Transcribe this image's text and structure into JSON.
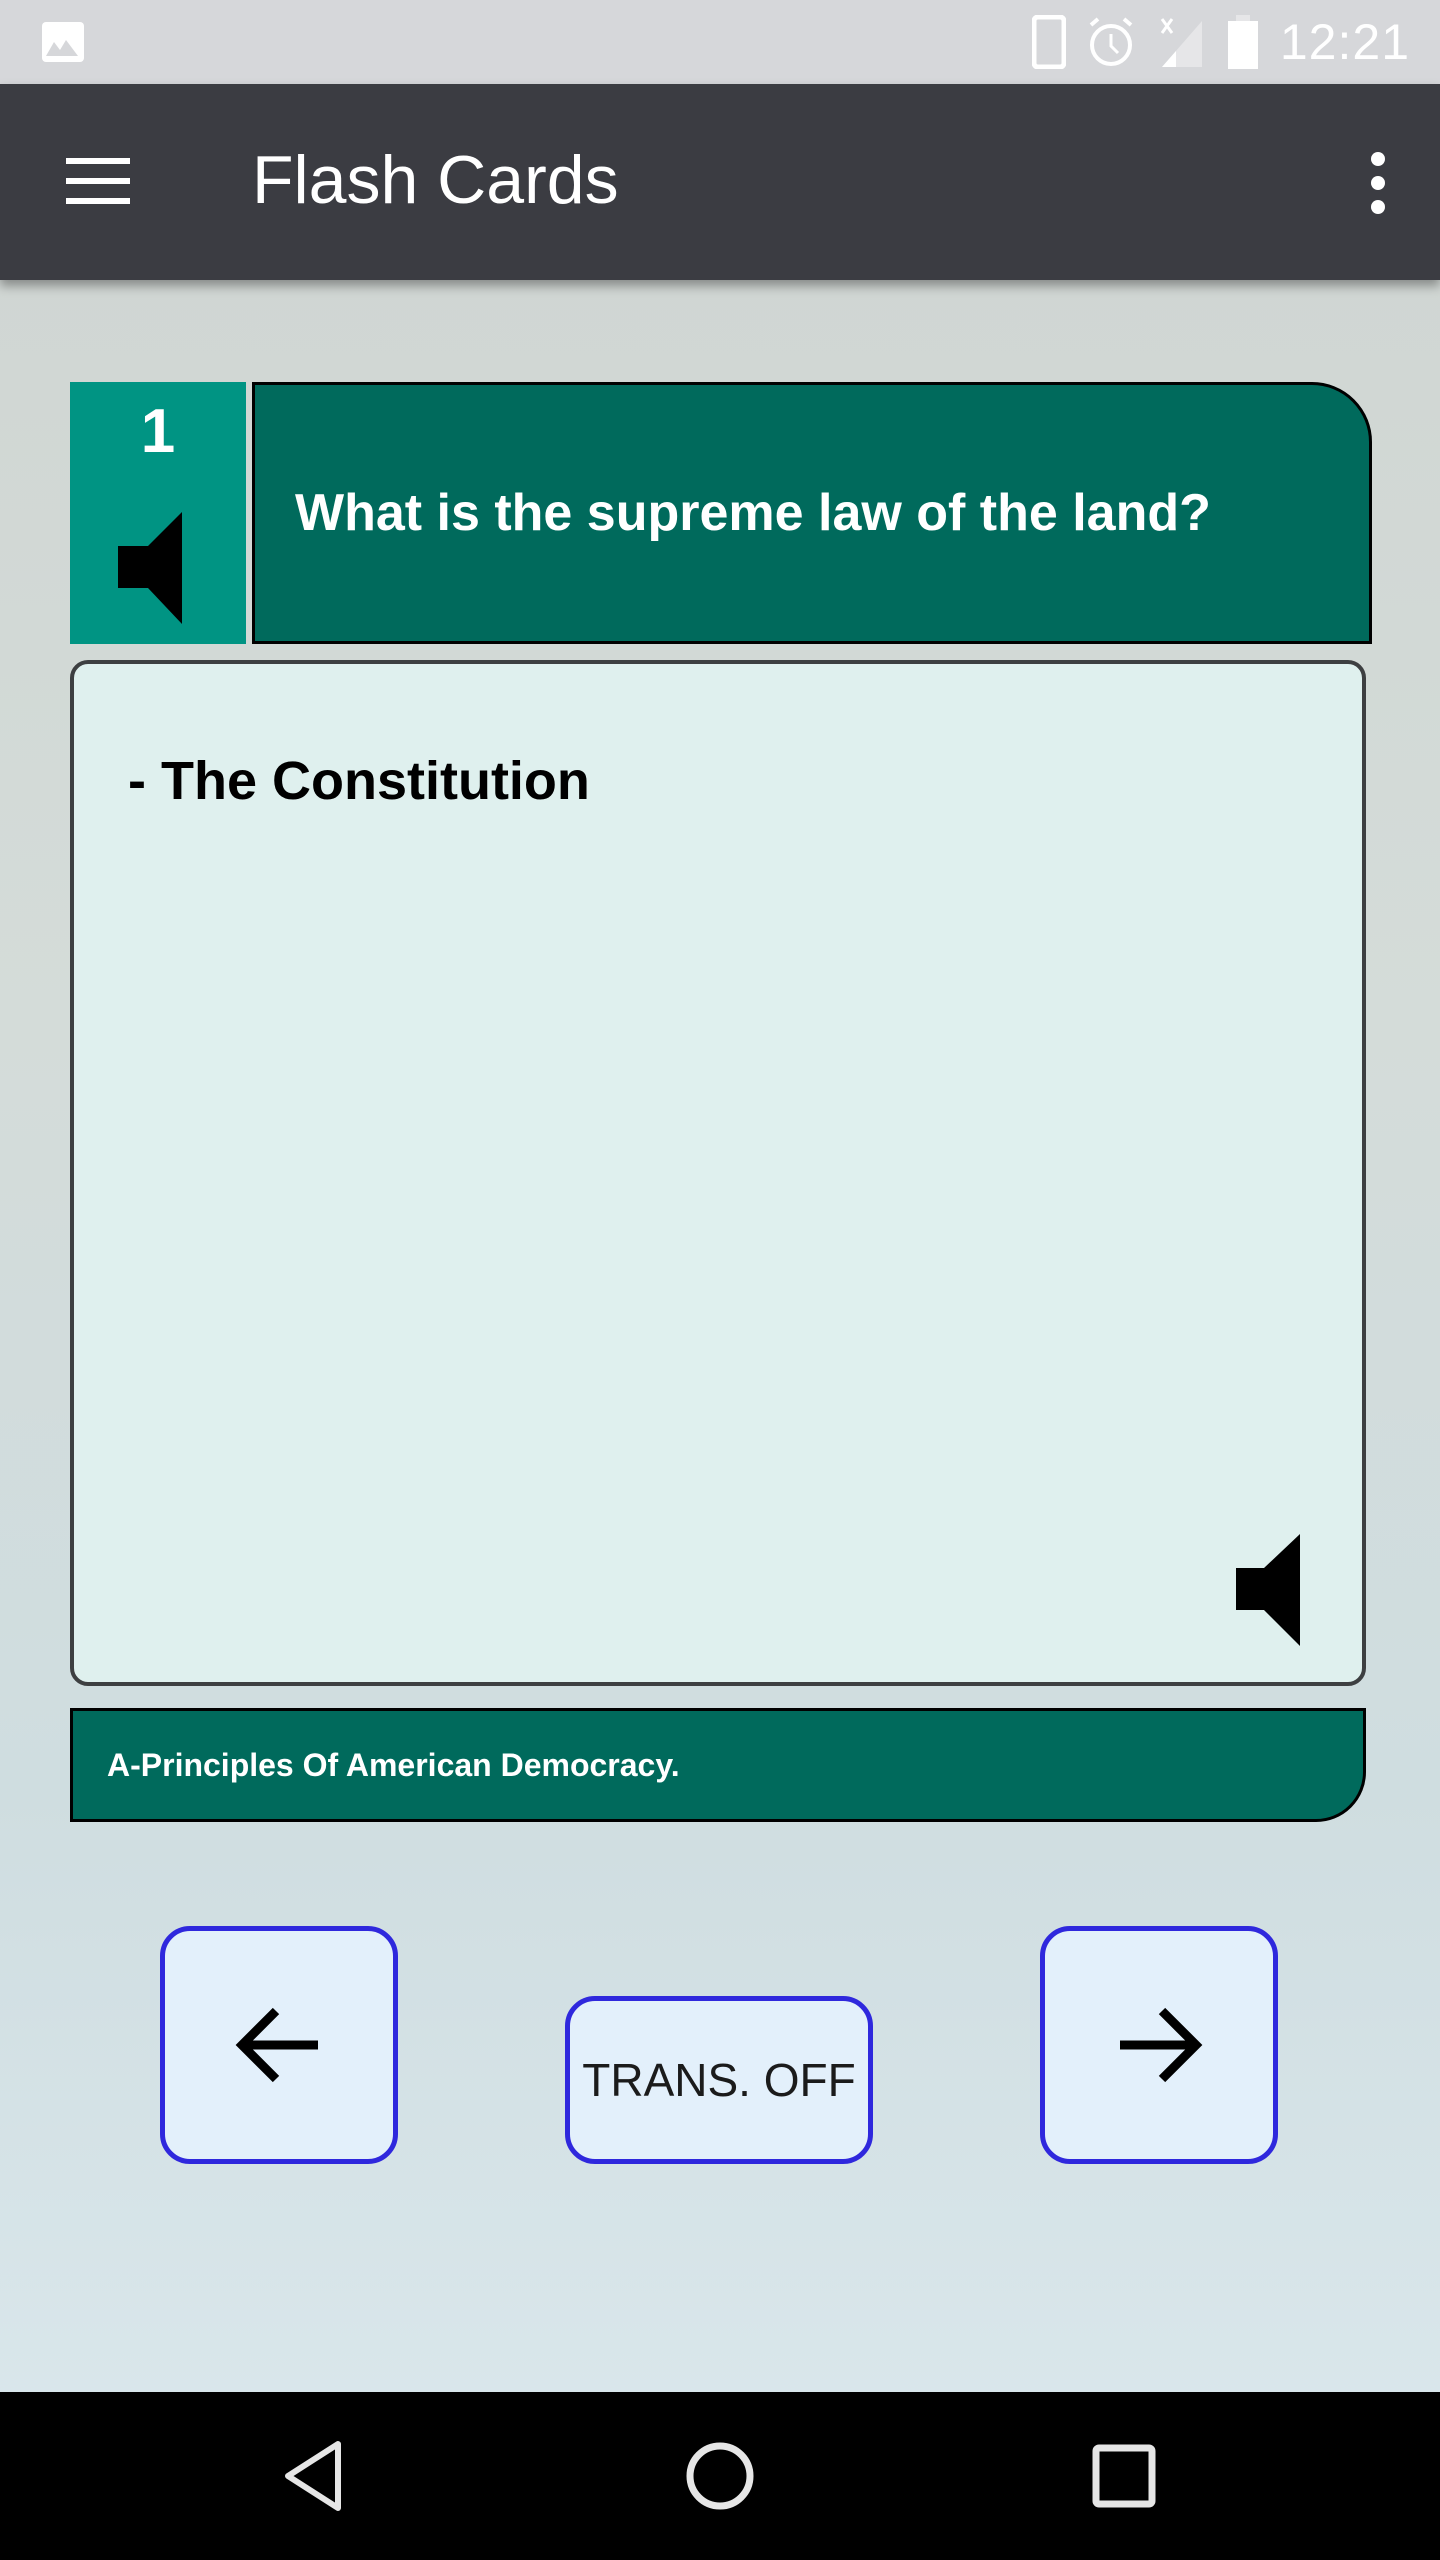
{
  "status_bar": {
    "time": "12:21",
    "icons": [
      "image-notification-icon",
      "phone-vibrate-icon",
      "alarm-icon",
      "no-signal-icon",
      "battery-icon"
    ]
  },
  "app_bar": {
    "title": "Flash Cards",
    "menu_icon": "hamburger-menu-icon",
    "overflow_icon": "more-vert-icon"
  },
  "card": {
    "number": "1",
    "question": "What is the supreme law of the land?",
    "answer": "- The Constitution",
    "category": "A-Principles Of American Democracy.",
    "speaker_icon": "speaker-icon"
  },
  "controls": {
    "prev_icon": "arrow-left-icon",
    "next_icon": "arrow-right-icon",
    "translation_label": "TRANS. OFF"
  },
  "colors": {
    "card_dark_green": "#006a5c",
    "number_teal": "#009483",
    "answer_bg": "#dff0ee",
    "button_border": "#2f28dd",
    "button_bg": "#e3f0fb",
    "app_bar": "#3b3c42"
  },
  "system_nav": {
    "back": "back-icon",
    "home": "home-icon",
    "recents": "recents-icon"
  }
}
